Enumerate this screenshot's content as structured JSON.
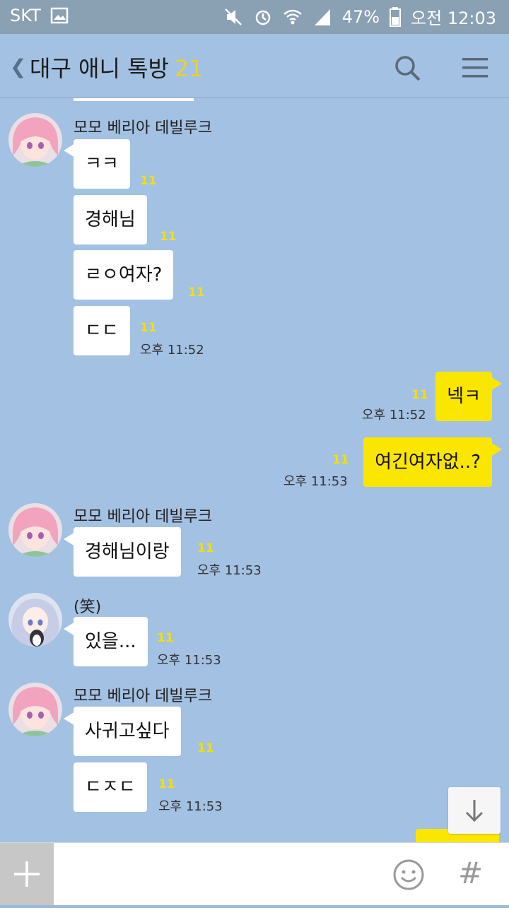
{
  "status_bar": {
    "carrier": "SKT",
    "battery": "47%",
    "time": "오전 12:03"
  },
  "header": {
    "title": "대구 애니 톡방",
    "member_count": "21"
  },
  "messages": [
    {
      "nick": "모모 베리아 데빌루크",
      "texts": [
        "ㅋㅋ",
        "경해님",
        "ㄹㅇ여자?",
        "ㄷㄷ"
      ],
      "unread": [
        "11",
        "11",
        "11",
        "11"
      ],
      "time": "오후 11:52"
    },
    {
      "me": true,
      "text": "넥ㅋ",
      "unread": "11",
      "time": "오후 11:52"
    },
    {
      "me": true,
      "text": "여긴여자없..?",
      "unread": "11",
      "time": "오후 11:53"
    },
    {
      "nick": "모모 베리아 데빌루크",
      "texts": [
        "경해님이랑"
      ],
      "unread": [
        "11"
      ],
      "time": "오후 11:53"
    },
    {
      "nick": "(笑)",
      "texts": [
        "있을..."
      ],
      "unread": [
        "11"
      ],
      "time": "오후 11:53"
    },
    {
      "nick": "모모 베리아 데빌루크",
      "texts": [
        "사귀고싶다",
        "ㄷㅈㄷ"
      ],
      "unread": [
        "11",
        "11"
      ],
      "time": "오후 11:53"
    }
  ],
  "input": {
    "placeholder": ""
  },
  "icons": {
    "back": "chevron-left-icon",
    "search": "search-icon",
    "menu": "hamburger-menu-icon",
    "scroll": "arrow-down-icon",
    "plus": "plus-icon",
    "emoji": "emoji-icon",
    "hash": "hash-icon"
  },
  "colors": {
    "chat_bg": "#a3c1e2",
    "my_bubble": "#fbe600",
    "unread": "#f3e000"
  }
}
